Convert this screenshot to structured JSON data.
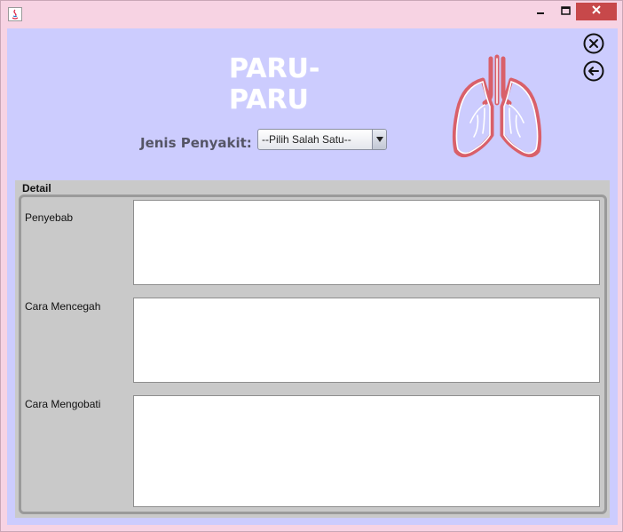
{
  "window": {
    "app_icon": "java-icon",
    "controls": [
      "minimize-icon",
      "maximize-icon",
      "close-icon"
    ]
  },
  "header": {
    "title": "PARU-PARU",
    "close_icon": "circle-x-icon",
    "back_icon": "circle-arrow-left-icon",
    "illustration": "lungs-icon"
  },
  "form": {
    "disease_label": "Jenis Penyakit:",
    "disease_select": {
      "selected": "--Pilih Salah Satu--"
    }
  },
  "detail": {
    "title": "Detail",
    "fields": [
      {
        "label": "Penyebab",
        "value": ""
      },
      {
        "label": "Cara Mencegah",
        "value": ""
      },
      {
        "label": "Cara Mengobati",
        "value": ""
      }
    ]
  },
  "colors": {
    "window_bg": "#f7d3e3",
    "content_bg": "#ccccfe",
    "close_button": "#c7484a",
    "lungs_stroke": "#d9606a"
  }
}
